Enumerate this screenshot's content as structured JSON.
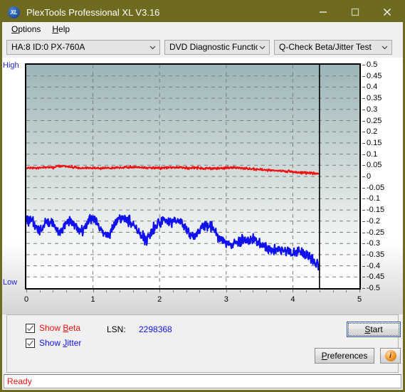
{
  "window": {
    "title": "PlexTools Professional XL V3.16",
    "icon": "xl-app-icon",
    "icon_text": "XL",
    "minimize": "minimize-icon",
    "maximize": "maximize-icon",
    "close": "close-icon"
  },
  "menu": {
    "items": [
      {
        "label": "Options",
        "accel": "O"
      },
      {
        "label": "Help",
        "accel": "H"
      }
    ]
  },
  "toolbar": {
    "drive": "HA:8 ID:0  PX-760A",
    "function": "DVD Diagnostic Functions",
    "test": "Q-Check Beta/Jitter Test",
    "chevron": "chevron-down-icon"
  },
  "controls": {
    "show_beta": "Show Beta",
    "show_jitter": "Show Jitter",
    "show_beta_checked": true,
    "show_jitter_checked": true,
    "lsn_label": "LSN:",
    "lsn_value": "2298368",
    "start": "Start",
    "preferences": "Preferences",
    "info": "info-icon",
    "info_glyph": "i"
  },
  "status": {
    "text": "Ready"
  },
  "chart_data": {
    "type": "line",
    "title": "Q-Check Beta/Jitter Test",
    "xlabel": "",
    "ylabel": "",
    "xlim": [
      0,
      5
    ],
    "ylim": [
      -0.5,
      0.5
    ],
    "grid": true,
    "legend_position": "bottom-left",
    "axis_labels": {
      "top_left": "High",
      "bottom_left": "Low"
    },
    "xticks": [
      0,
      1,
      2,
      3,
      4,
      5
    ],
    "yticks": [
      0.5,
      0.45,
      0.4,
      0.35,
      0.3,
      0.25,
      0.2,
      0.15,
      0.1,
      0.05,
      0,
      -0.05,
      -0.1,
      -0.15,
      -0.2,
      -0.25,
      -0.3,
      -0.35,
      -0.4,
      -0.45,
      -0.5
    ],
    "cursor_x": 4.4,
    "data_end_x": 4.4,
    "colors": {
      "beta": "#ee1111",
      "jitter": "#1111ee",
      "cursor": "#000000"
    },
    "series": [
      {
        "name": "Beta",
        "color": "#ee1111",
        "x": [
          0.0,
          0.1,
          0.2,
          0.3,
          0.4,
          0.5,
          0.6,
          0.7,
          0.8,
          0.9,
          1.0,
          1.1,
          1.2,
          1.3,
          1.4,
          1.5,
          1.6,
          1.7,
          1.8,
          1.9,
          2.0,
          2.1,
          2.2,
          2.3,
          2.4,
          2.5,
          2.6,
          2.7,
          2.8,
          2.9,
          3.0,
          3.1,
          3.2,
          3.3,
          3.4,
          3.5,
          3.6,
          3.7,
          3.8,
          3.9,
          4.0,
          4.1,
          4.2,
          4.3,
          4.4
        ],
        "values": [
          0.038,
          0.037,
          0.038,
          0.04,
          0.039,
          0.047,
          0.044,
          0.041,
          0.039,
          0.038,
          0.037,
          0.037,
          0.038,
          0.039,
          0.04,
          0.041,
          0.042,
          0.041,
          0.04,
          0.039,
          0.038,
          0.04,
          0.041,
          0.04,
          0.039,
          0.038,
          0.037,
          0.036,
          0.035,
          0.036,
          0.038,
          0.04,
          0.039,
          0.036,
          0.033,
          0.031,
          0.029,
          0.027,
          0.025,
          0.023,
          0.021,
          0.018,
          0.016,
          0.014,
          0.012
        ]
      },
      {
        "name": "Jitter",
        "color": "#1111ee",
        "x": [
          0.0,
          0.05,
          0.1,
          0.15,
          0.2,
          0.25,
          0.3,
          0.35,
          0.4,
          0.45,
          0.5,
          0.55,
          0.6,
          0.65,
          0.7,
          0.75,
          0.8,
          0.85,
          0.9,
          0.95,
          1.0,
          1.05,
          1.1,
          1.15,
          1.2,
          1.25,
          1.3,
          1.35,
          1.4,
          1.45,
          1.5,
          1.55,
          1.6,
          1.65,
          1.7,
          1.75,
          1.8,
          1.85,
          1.9,
          1.95,
          2.0,
          2.05,
          2.1,
          2.15,
          2.2,
          2.25,
          2.3,
          2.35,
          2.4,
          2.45,
          2.5,
          2.55,
          2.6,
          2.65,
          2.7,
          2.75,
          2.8,
          2.85,
          2.9,
          2.95,
          3.0,
          3.05,
          3.1,
          3.15,
          3.2,
          3.25,
          3.3,
          3.35,
          3.4,
          3.45,
          3.5,
          3.55,
          3.6,
          3.65,
          3.7,
          3.75,
          3.8,
          3.85,
          3.9,
          3.95,
          4.0,
          4.05,
          4.1,
          4.15,
          4.2,
          4.25,
          4.3,
          4.35,
          4.4
        ],
        "values": [
          -0.205,
          -0.19,
          -0.2,
          -0.23,
          -0.25,
          -0.225,
          -0.2,
          -0.195,
          -0.215,
          -0.245,
          -0.255,
          -0.23,
          -0.205,
          -0.195,
          -0.2,
          -0.225,
          -0.25,
          -0.24,
          -0.21,
          -0.195,
          -0.192,
          -0.205,
          -0.23,
          -0.255,
          -0.275,
          -0.255,
          -0.225,
          -0.2,
          -0.19,
          -0.188,
          -0.19,
          -0.2,
          -0.215,
          -0.235,
          -0.255,
          -0.27,
          -0.285,
          -0.27,
          -0.24,
          -0.215,
          -0.2,
          -0.196,
          -0.198,
          -0.205,
          -0.2,
          -0.196,
          -0.2,
          -0.215,
          -0.235,
          -0.255,
          -0.27,
          -0.26,
          -0.24,
          -0.225,
          -0.218,
          -0.222,
          -0.235,
          -0.255,
          -0.275,
          -0.29,
          -0.3,
          -0.305,
          -0.302,
          -0.296,
          -0.292,
          -0.29,
          -0.292,
          -0.288,
          -0.28,
          -0.286,
          -0.3,
          -0.31,
          -0.318,
          -0.325,
          -0.33,
          -0.334,
          -0.332,
          -0.33,
          -0.334,
          -0.338,
          -0.336,
          -0.33,
          -0.334,
          -0.342,
          -0.35,
          -0.36,
          -0.375,
          -0.395,
          -0.408
        ]
      }
    ]
  }
}
